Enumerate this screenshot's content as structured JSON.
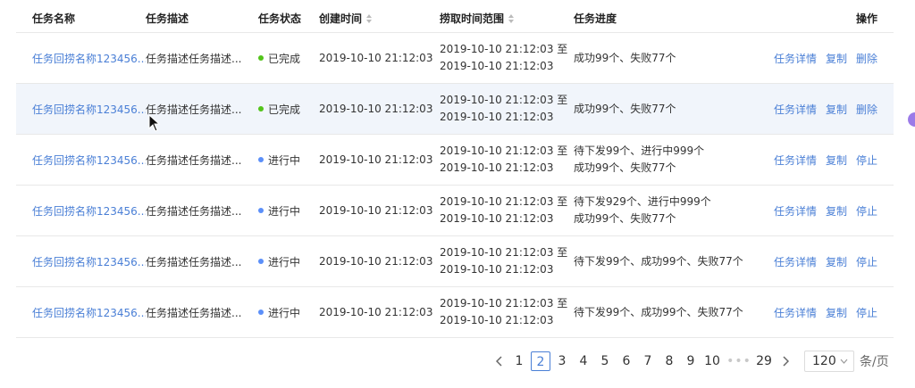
{
  "colors": {
    "link": "#4a7fd6",
    "done": "#52c41a",
    "running": "#5b8ff9"
  },
  "table": {
    "headers": {
      "name": "任务名称",
      "desc": "任务描述",
      "status": "任务状态",
      "created": "创建时间",
      "range": "捞取时间范围",
      "progress": "任务进度",
      "ops": "操作"
    },
    "rows": [
      {
        "name": "任务回捞名称123456...",
        "desc": "任务描述任务描述...",
        "status": "已完成",
        "status_type": "done",
        "created": "2019-10-10  21:12:03",
        "range1": "2019-10-10  21:12:03 至",
        "range2": "2019-10-10  21:12:03",
        "progress1": "成功99个、失败77个",
        "progress2": "",
        "op1": "任务详情",
        "op2": "复制",
        "op3": "删除"
      },
      {
        "name": "任务回捞名称123456...",
        "desc": "任务描述任务描述...",
        "status": "已完成",
        "status_type": "done",
        "created": "2019-10-10  21:12:03",
        "range1": "2019-10-10  21:12:03 至",
        "range2": "2019-10-10  21:12:03",
        "progress1": "成功99个、失败77个",
        "progress2": "",
        "op1": "任务详情",
        "op2": "复制",
        "op3": "删除"
      },
      {
        "name": "任务回捞名称123456...",
        "desc": "任务描述任务描述...",
        "status": "进行中",
        "status_type": "running",
        "created": "2019-10-10  21:12:03",
        "range1": "2019-10-10  21:12:03 至",
        "range2": "2019-10-10  21:12:03",
        "progress1": "待下发99个、进行中999个",
        "progress2": "成功99个、失败77个",
        "op1": "任务详情",
        "op2": "复制",
        "op3": "停止"
      },
      {
        "name": "任务回捞名称123456...",
        "desc": "任务描述任务描述...",
        "status": "进行中",
        "status_type": "running",
        "created": "2019-10-10  21:12:03",
        "range1": "2019-10-10  21:12:03 至",
        "range2": "2019-10-10  21:12:03",
        "progress1": "待下发929个、进行中999个",
        "progress2": "成功99个、失败77个",
        "op1": "任务详情",
        "op2": "复制",
        "op3": "停止"
      },
      {
        "name": "任务回捞名称123456...",
        "desc": "任务描述任务描述...",
        "status": "进行中",
        "status_type": "running",
        "created": "2019-10-10  21:12:03",
        "range1": "2019-10-10  21:12:03 至",
        "range2": "2019-10-10  21:12:03",
        "progress1": "待下发99个、成功99个、失败77个",
        "progress2": "",
        "op1": "任务详情",
        "op2": "复制",
        "op3": "停止"
      },
      {
        "name": "任务回捞名称123456...",
        "desc": "任务描述任务描述...",
        "status": "进行中",
        "status_type": "running",
        "created": "2019-10-10  21:12:03",
        "range1": "2019-10-10  21:12:03 至",
        "range2": "2019-10-10  21:12:03",
        "progress1": "待下发99个、成功99个、失败77个",
        "progress2": "",
        "op1": "任务详情",
        "op2": "复制",
        "op3": "停止"
      }
    ]
  },
  "pagination": {
    "prev_icon": "chevron-left-icon",
    "next_icon": "chevron-right-icon",
    "pages_before": [
      "1"
    ],
    "current": "2",
    "pages_after": [
      "3",
      "4",
      "5",
      "6",
      "7",
      "8",
      "9",
      "10"
    ],
    "ellipsis": "•••",
    "last": "29",
    "page_size": "120",
    "page_size_unit": "条/页"
  }
}
